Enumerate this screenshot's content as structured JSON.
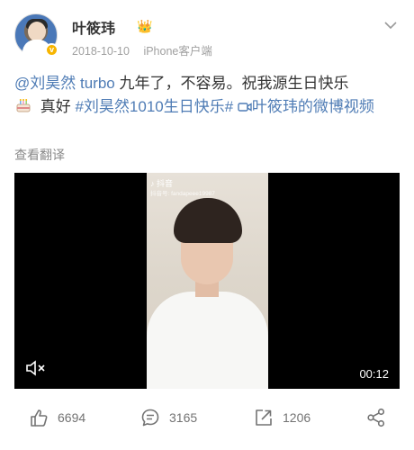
{
  "header": {
    "username": "叶筱玮",
    "date": "2018-10-10",
    "source": "iPhone客户端"
  },
  "post": {
    "mention": "@刘昊然 turbo",
    "text_after_mention": " 九年了，不容易。祝我源生日快乐",
    "line2_text": " 真好 ",
    "hashtag": "#刘昊然1010生日快乐#",
    "video_link": "叶筱玮的微博视频",
    "translate": "查看翻译"
  },
  "video": {
    "watermark_logo": "抖音",
    "watermark_id": "抖音号: fandapeee19987",
    "duration": "00:12"
  },
  "actions": {
    "likes": "6694",
    "comments": "3165",
    "reposts": "1206"
  },
  "colors": {
    "link": "#4f7cb5",
    "text": "#333333",
    "meta": "#a0a0a0",
    "icon": "#737373"
  }
}
